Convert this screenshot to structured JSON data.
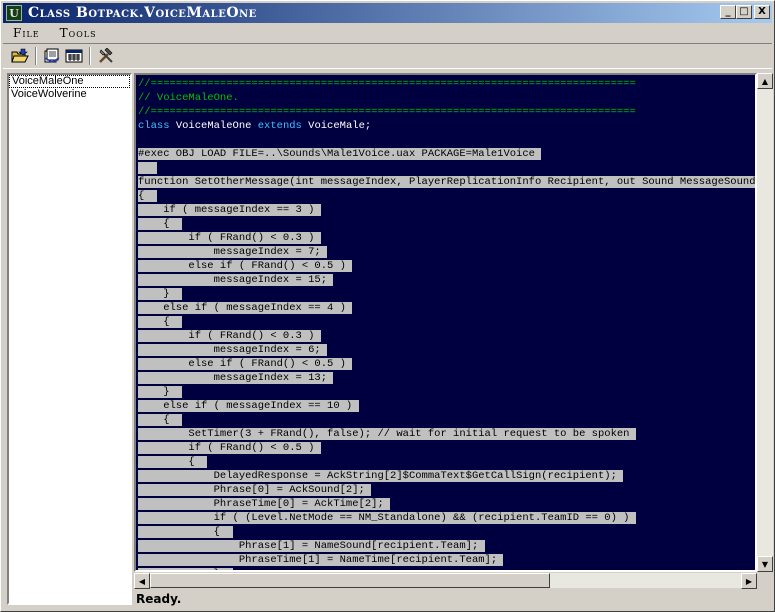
{
  "window": {
    "title": "Class Botpack.VoiceMaleOne",
    "minimize_glyph": "_",
    "maximize_glyph": "□",
    "close_glyph": "X"
  },
  "menu": {
    "file": "File",
    "tools": "Tools"
  },
  "toolbar": {
    "icons": [
      "open-folder-icon",
      "export-icon",
      "compile-icon",
      "tools-icon"
    ]
  },
  "class_list": {
    "items": [
      "VoiceMaleOne",
      "VoiceWolverine"
    ],
    "selected": "VoiceMaleOne"
  },
  "editor": {
    "lines": [
      {
        "text": "//=============================================================================",
        "style": "c"
      },
      {
        "text": "// VoiceMaleOne.",
        "style": "c"
      },
      {
        "text": "//=============================================================================",
        "style": "c"
      },
      {
        "text": "class VoiceMaleOne extends VoiceMale;",
        "style": "class"
      },
      {
        "text": "",
        "style": "pl"
      },
      {
        "text": "#exec OBJ LOAD FILE=..\\Sounds\\Male1Voice.uax PACKAGE=Male1Voice ",
        "style": "sel"
      },
      {
        "text": "   ",
        "style": "sel"
      },
      {
        "text": "function SetOtherMessage(int messageIndex, PlayerReplicationInfo Recipient, out Sound MessageSound, out Float MessageTime)",
        "style": "sel"
      },
      {
        "text": "{  ",
        "style": "sel"
      },
      {
        "text": "    if ( messageIndex == 3 ) ",
        "style": "sel"
      },
      {
        "text": "    {  ",
        "style": "sel"
      },
      {
        "text": "        if ( FRand() < 0.3 ) ",
        "style": "sel"
      },
      {
        "text": "            messageIndex = 7; ",
        "style": "sel"
      },
      {
        "text": "        else if ( FRand() < 0.5 ) ",
        "style": "sel"
      },
      {
        "text": "            messageIndex = 15; ",
        "style": "sel"
      },
      {
        "text": "    }  ",
        "style": "sel"
      },
      {
        "text": "    else if ( messageIndex == 4 ) ",
        "style": "sel"
      },
      {
        "text": "    {  ",
        "style": "sel"
      },
      {
        "text": "        if ( FRand() < 0.3 ) ",
        "style": "sel"
      },
      {
        "text": "            messageIndex = 6; ",
        "style": "sel"
      },
      {
        "text": "        else if ( FRand() < 0.5 ) ",
        "style": "sel"
      },
      {
        "text": "            messageIndex = 13; ",
        "style": "sel"
      },
      {
        "text": "    }  ",
        "style": "sel"
      },
      {
        "text": "    else if ( messageIndex == 10 ) ",
        "style": "sel"
      },
      {
        "text": "    {  ",
        "style": "sel"
      },
      {
        "text": "        SetTimer(3 + FRand(), false); // wait for initial request to be spoken ",
        "style": "sel"
      },
      {
        "text": "        if ( FRand() < 0.5 ) ",
        "style": "sel"
      },
      {
        "text": "        {  ",
        "style": "sel"
      },
      {
        "text": "            DelayedResponse = AckString[2]$CommaText$GetCallSign(recipient); ",
        "style": "sel"
      },
      {
        "text": "            Phrase[0] = AckSound[2]; ",
        "style": "sel"
      },
      {
        "text": "            PhraseTime[0] = AckTime[2]; ",
        "style": "sel"
      },
      {
        "text": "            if ( (Level.NetMode == NM_Standalone) && (recipient.TeamID == 0) ) ",
        "style": "sel"
      },
      {
        "text": "            {  ",
        "style": "sel"
      },
      {
        "text": "                Phrase[1] = NameSound[recipient.Team]; ",
        "style": "sel"
      },
      {
        "text": "                PhraseTime[1] = NameTime[recipient.Team]; ",
        "style": "sel"
      },
      {
        "text": "            }  ",
        "style": "sel"
      }
    ]
  },
  "status": {
    "text": "Ready."
  }
}
